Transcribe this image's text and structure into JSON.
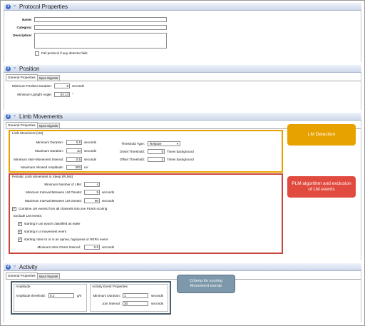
{
  "protocol": {
    "num": "1",
    "title": "Protocol Properties",
    "name_label": "Name:",
    "category_label": "Category:",
    "description_label": "Description:",
    "name_value": "",
    "category_value": "",
    "description_value": "",
    "fail_label": "Fail protocol if any detector fails"
  },
  "position": {
    "num": "2",
    "title": "Position",
    "tabs": [
      "General Properties",
      "Input Signals"
    ],
    "min_duration_label": "Minimum Position Duration:",
    "min_duration_value": "5",
    "min_duration_unit": "seconds",
    "min_angle_label": "Minimum Upright Angle:",
    "min_angle_value": "53.13",
    "min_angle_unit": "°"
  },
  "limb": {
    "num": "3",
    "title": "Limb Movements",
    "tabs": [
      "General Properties",
      "Input Signals"
    ],
    "lm_group": "Limb Movement (LM)",
    "min_dur_label": "Minimum Duration:",
    "min_dur_value": "0.5",
    "min_dur_unit": "seconds",
    "max_dur_label": "Maximum Duration:",
    "max_dur_value": "10",
    "max_dur_unit": "seconds",
    "min_imi_label": "Minimum Inter-Movement Interval:",
    "min_imi_value": "0.5",
    "min_imi_unit": "seconds",
    "max_amp_label": "Maximum Allowed Amplitude:",
    "max_amp_value": "300",
    "max_amp_unit": "uV",
    "thr_type_label": "Threshold Type:",
    "thr_type_value": "Relative",
    "onset_label": "Onset Threshold:",
    "onset_value": "5",
    "onset_unit": "Times background",
    "offset_label": "Offset Threshold:",
    "offset_value": "3",
    "offset_unit": "Times background",
    "plms_group": "Periodic Limb Movement in Sleep (PLMS)",
    "min_lms_label": "Minimum Number of LMs:",
    "min_lms_value": "4",
    "min_int_label": "Minimum Interval Between LM Onsets:",
    "min_int_value": "5",
    "min_int_unit": "seconds",
    "max_int_label": "Maximum Interval Between LM Onsets:",
    "max_int_value": "90",
    "max_int_unit": "seconds",
    "combine_label": "Combine LM events from all channels into one PLMS scoring",
    "exclude_label": "Exclude LM events:",
    "ex1_label": "starting in an epoch classified as wake",
    "ex2_label": "starting in a movement event",
    "ex3_label": "starting close to or in an apnea, hypopnea or RERA event",
    "inter_onset_label": "Minimum Inter-Onset Interval:",
    "inter_onset_value": "0.5",
    "inter_onset_unit": "seconds"
  },
  "activity": {
    "num": "4",
    "title": "Activity",
    "tabs": [
      "General Properties",
      "Input Signals"
    ],
    "amp_group": "Amplitude",
    "amp_thr_label": "Amplitude threshold:",
    "amp_thr_value": "0.2",
    "amp_thr_unit": "g/s",
    "evt_group": "Activity Event Properties",
    "min_dur_label": "Minimum Duration:",
    "min_dur_value": "1",
    "min_dur_unit": "seconds",
    "join_label": "Join Interval:",
    "join_value": "30",
    "join_unit": "seconds"
  },
  "callouts": {
    "lm_detection": "LM Detection",
    "plm_algorithm": "PLM algorithm and exclusion of LM events",
    "criteria": "Criteria for scoring Movement events"
  },
  "colors": {
    "orange": "#e8a200",
    "red": "#e14b3f",
    "slate": "#7d97ab",
    "header_blue": "#3c6fc4"
  },
  "checked_symbol": "✓"
}
